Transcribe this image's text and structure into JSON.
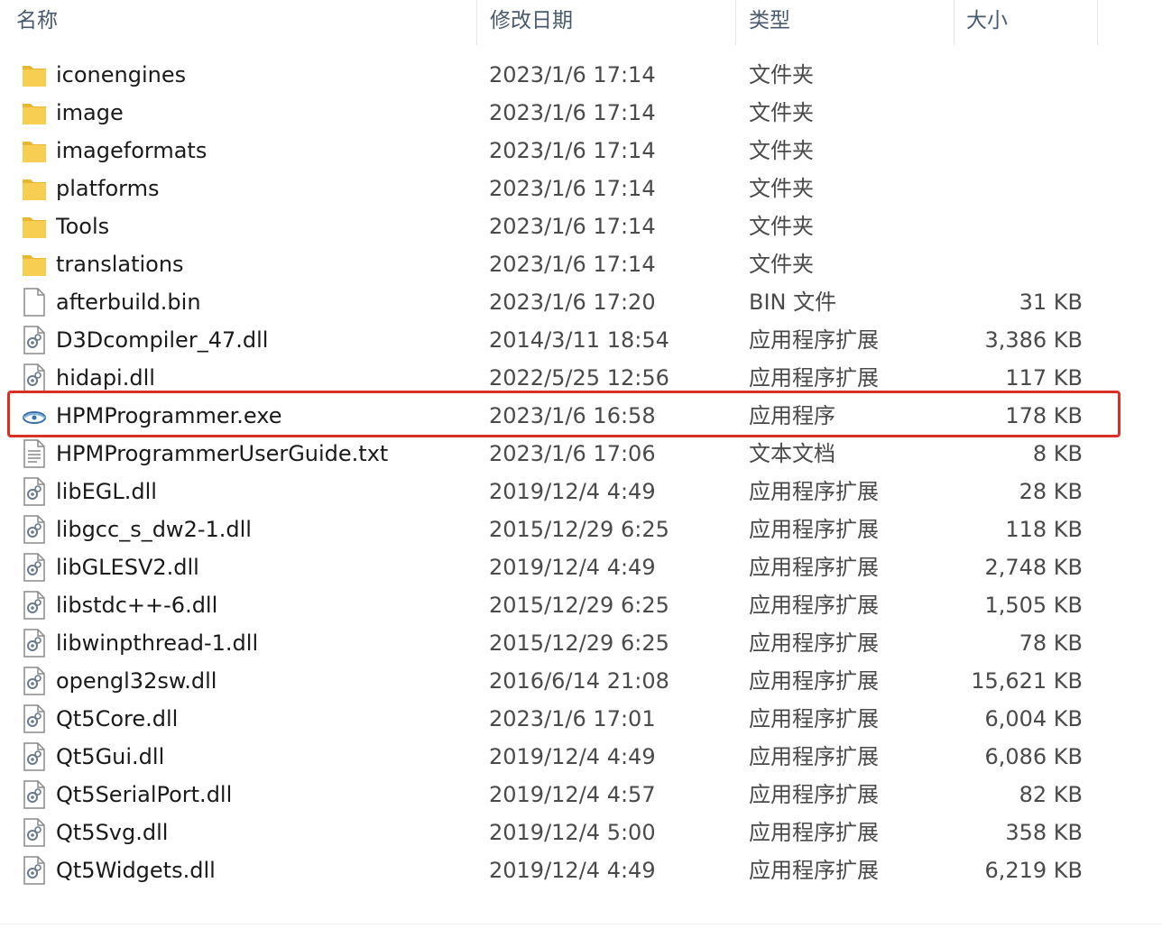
{
  "columns": {
    "name": "名称",
    "modified": "修改日期",
    "type": "类型",
    "size": "大小"
  },
  "files": [
    {
      "name": "iconengines",
      "date": "2023/1/6 17:14",
      "type": "文件夹",
      "size": "",
      "icon": "folder-icon"
    },
    {
      "name": "image",
      "date": "2023/1/6 17:14",
      "type": "文件夹",
      "size": "",
      "icon": "folder-icon"
    },
    {
      "name": "imageformats",
      "date": "2023/1/6 17:14",
      "type": "文件夹",
      "size": "",
      "icon": "folder-icon"
    },
    {
      "name": "platforms",
      "date": "2023/1/6 17:14",
      "type": "文件夹",
      "size": "",
      "icon": "folder-icon"
    },
    {
      "name": "Tools",
      "date": "2023/1/6 17:14",
      "type": "文件夹",
      "size": "",
      "icon": "folder-icon"
    },
    {
      "name": "translations",
      "date": "2023/1/6 17:14",
      "type": "文件夹",
      "size": "",
      "icon": "folder-icon"
    },
    {
      "name": "afterbuild.bin",
      "date": "2023/1/6 17:20",
      "type": "BIN 文件",
      "size": "31 KB",
      "icon": "file-icon"
    },
    {
      "name": "D3Dcompiler_47.dll",
      "date": "2014/3/11 18:54",
      "type": "应用程序扩展",
      "size": "3,386 KB",
      "icon": "dll-icon"
    },
    {
      "name": "hidapi.dll",
      "date": "2022/5/25 12:56",
      "type": "应用程序扩展",
      "size": "117 KB",
      "icon": "dll-icon"
    },
    {
      "name": "HPMProgrammer.exe",
      "date": "2023/1/6 16:58",
      "type": "应用程序",
      "size": "178 KB",
      "icon": "exe-icon"
    },
    {
      "name": "HPMProgrammerUserGuide.txt",
      "date": "2023/1/6 17:06",
      "type": "文本文档",
      "size": "8 KB",
      "icon": "text-file-icon"
    },
    {
      "name": "libEGL.dll",
      "date": "2019/12/4 4:49",
      "type": "应用程序扩展",
      "size": "28 KB",
      "icon": "dll-icon"
    },
    {
      "name": "libgcc_s_dw2-1.dll",
      "date": "2015/12/29 6:25",
      "type": "应用程序扩展",
      "size": "118 KB",
      "icon": "dll-icon"
    },
    {
      "name": "libGLESV2.dll",
      "date": "2019/12/4 4:49",
      "type": "应用程序扩展",
      "size": "2,748 KB",
      "icon": "dll-icon"
    },
    {
      "name": "libstdc++-6.dll",
      "date": "2015/12/29 6:25",
      "type": "应用程序扩展",
      "size": "1,505 KB",
      "icon": "dll-icon"
    },
    {
      "name": "libwinpthread-1.dll",
      "date": "2015/12/29 6:25",
      "type": "应用程序扩展",
      "size": "78 KB",
      "icon": "dll-icon"
    },
    {
      "name": "opengl32sw.dll",
      "date": "2016/6/14 21:08",
      "type": "应用程序扩展",
      "size": "15,621 KB",
      "icon": "dll-icon"
    },
    {
      "name": "Qt5Core.dll",
      "date": "2023/1/6 17:01",
      "type": "应用程序扩展",
      "size": "6,004 KB",
      "icon": "dll-icon"
    },
    {
      "name": "Qt5Gui.dll",
      "date": "2019/12/4 4:49",
      "type": "应用程序扩展",
      "size": "6,086 KB",
      "icon": "dll-icon"
    },
    {
      "name": "Qt5SerialPort.dll",
      "date": "2019/12/4 4:57",
      "type": "应用程序扩展",
      "size": "82 KB",
      "icon": "dll-icon"
    },
    {
      "name": "Qt5Svg.dll",
      "date": "2019/12/4 5:00",
      "type": "应用程序扩展",
      "size": "358 KB",
      "icon": "dll-icon"
    },
    {
      "name": "Qt5Widgets.dll",
      "date": "2019/12/4 4:49",
      "type": "应用程序扩展",
      "size": "6,219 KB",
      "icon": "dll-icon"
    }
  ],
  "highlight_color": "#d93025",
  "folder_color": "#f5c748"
}
